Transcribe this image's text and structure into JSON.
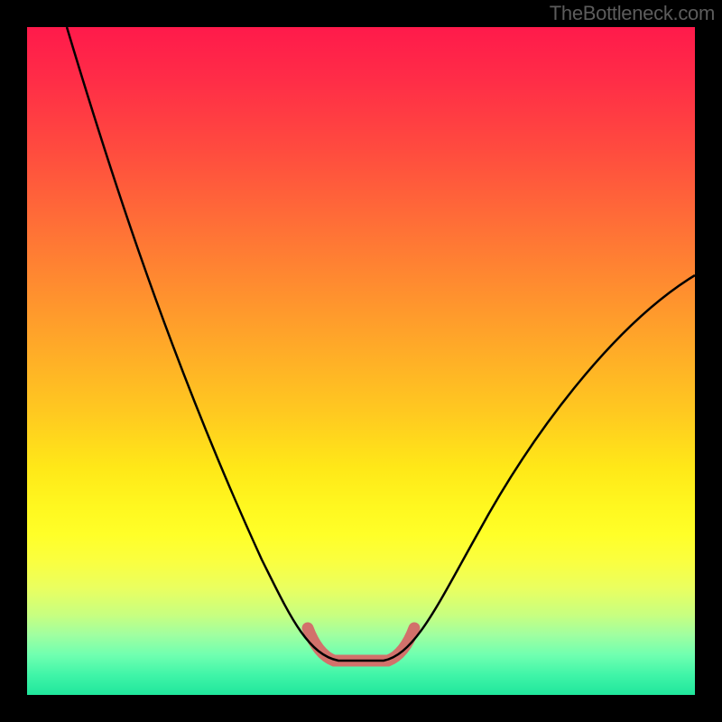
{
  "watermark": "TheBottleneck.com",
  "chart_data": {
    "type": "line",
    "title": "",
    "xlabel": "",
    "ylabel": "",
    "xlim": [
      0,
      100
    ],
    "ylim": [
      0,
      100
    ],
    "series": [
      {
        "name": "bottleneck-curve",
        "x": [
          0,
          5,
          10,
          15,
          20,
          25,
          30,
          35,
          40,
          43,
          45,
          47,
          50,
          52,
          54,
          56,
          60,
          65,
          70,
          75,
          80,
          85,
          90,
          95,
          100
        ],
        "y": [
          100,
          90,
          80,
          70,
          60,
          50,
          40,
          30,
          18,
          10,
          6,
          5,
          5,
          5,
          6,
          10,
          16,
          24,
          32,
          39,
          46,
          52,
          57,
          60,
          62
        ]
      },
      {
        "name": "valley-highlight",
        "x": [
          42,
          44,
          46,
          48,
          50,
          52,
          54,
          56
        ],
        "y": [
          10,
          6,
          5,
          5,
          5,
          5,
          7,
          11
        ],
        "color": "#d2716b",
        "stroke_width": 12
      }
    ]
  },
  "colors": {
    "background": "#000000",
    "curve": "#000000",
    "valley_highlight": "#d2716b",
    "watermark": "#5c5c5c"
  }
}
